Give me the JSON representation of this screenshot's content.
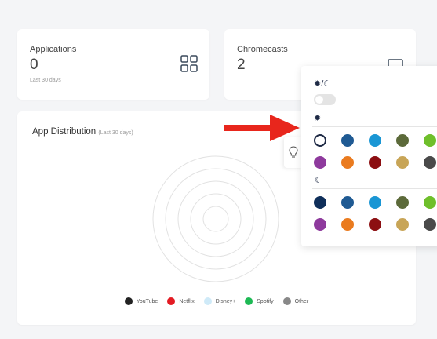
{
  "cards": {
    "applications": {
      "title": "Applications",
      "value": "0",
      "subtitle": "Last 30 days",
      "icon": "grid-icon"
    },
    "chromecasts": {
      "title": "Chromecasts",
      "value": "2",
      "icon": "cast-icon"
    }
  },
  "distribution": {
    "title": "App Distribution",
    "subtitle": "(Last 30 days)",
    "legend": [
      {
        "label": "YouTube",
        "color": "#222222"
      },
      {
        "label": "Netflix",
        "color": "#e31b23"
      },
      {
        "label": "Disney+",
        "color": "#cfeaf8"
      },
      {
        "label": "Spotify",
        "color": "#1db954"
      },
      {
        "label": "Other",
        "color": "#888888"
      }
    ]
  },
  "theme_panel": {
    "auto_icon": "sun-moon-icon",
    "auto_glyph": "✹/☾",
    "auto_toggle_on": false,
    "light_icon": "sun-icon",
    "light_glyph": "✹",
    "dark_icon": "moon-icon",
    "dark_glyph": "☾",
    "tab_icon": "lightbulb-icon",
    "light_colors": [
      "#ffffff",
      "#1f5a93",
      "#1a96d4",
      "#5c6a3a",
      "#6fbf2b",
      "#8e3a9d",
      "#ea7b1f",
      "#8c0f12",
      "#c8a557",
      "#4a4a4a"
    ],
    "light_selected": 0,
    "dark_colors": [
      "#0f2f5a",
      "#1f5a93",
      "#1a96d4",
      "#5c6a3a",
      "#6fbf2b",
      "#8e3a9d",
      "#ea7b1f",
      "#8c0f12",
      "#c8a557",
      "#4a4a4a"
    ]
  },
  "colors": {
    "arrow": "#e8261c"
  }
}
